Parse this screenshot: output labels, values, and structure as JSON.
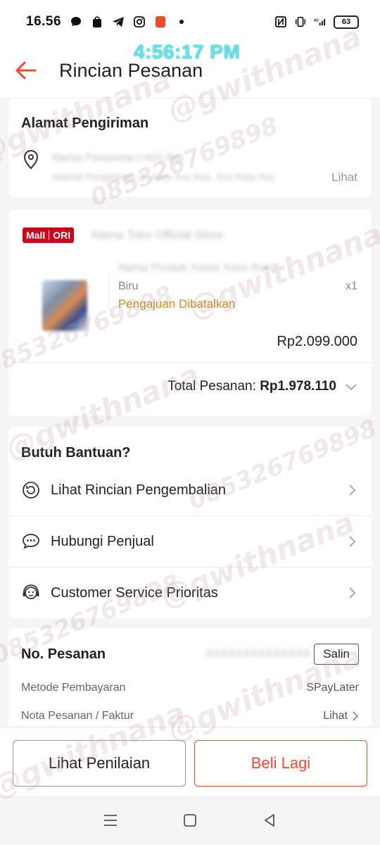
{
  "status_bar": {
    "time": "16.56",
    "battery": "63",
    "network": "4G"
  },
  "overlay_clock": "4:56:17 PM",
  "header": {
    "title": "Rincian Pesanan"
  },
  "address": {
    "title": "Alamat Pengiriman",
    "line1": "Nama Penerima (+62) 8xx",
    "line2": "Alamat Pengiriman Jl. Xxxx Xxx Kec. Xxx Kota Xxx",
    "view_label": "Lihat"
  },
  "order_item": {
    "badge_mall": "Mall",
    "badge_ori": "ORI",
    "shop_name": "Nama Toko Official Store",
    "product_name": "Nama Produk Xxxxx Xxxx Xxxx",
    "variation": "Biru",
    "quantity": "x1",
    "status": "Pengajuan Dibatalkan",
    "price": "Rp2.099.000",
    "total_label": "Total Pesanan:",
    "total_value": "Rp1.978.110"
  },
  "help": {
    "title": "Butuh Bantuan?",
    "items": [
      {
        "label": "Lihat Rincian Pengembalian",
        "icon": "return-icon"
      },
      {
        "label": "Hubungi Penjual",
        "icon": "chat-icon"
      },
      {
        "label": "Customer Service Prioritas",
        "icon": "support-agent-icon"
      }
    ]
  },
  "order_info": {
    "title": "No. Pesanan",
    "order_number": "XXXXXXXXXXXXXX",
    "copy_label": "Salin",
    "payment_label": "Metode Pembayaran",
    "payment_value": "SPayLater",
    "invoice_label": "Nota Pesanan / Faktur",
    "invoice_value": "Lihat"
  },
  "actions": {
    "review_label": "Lihat Penilaian",
    "buy_again_label": "Beli Lagi"
  },
  "watermark": {
    "handle": "@gwithnana",
    "phone": "085326769898"
  },
  "colors": {
    "brand": "#ee4d2d",
    "status_cancel": "#d48a1a",
    "mall_badge": "#d0011b"
  }
}
